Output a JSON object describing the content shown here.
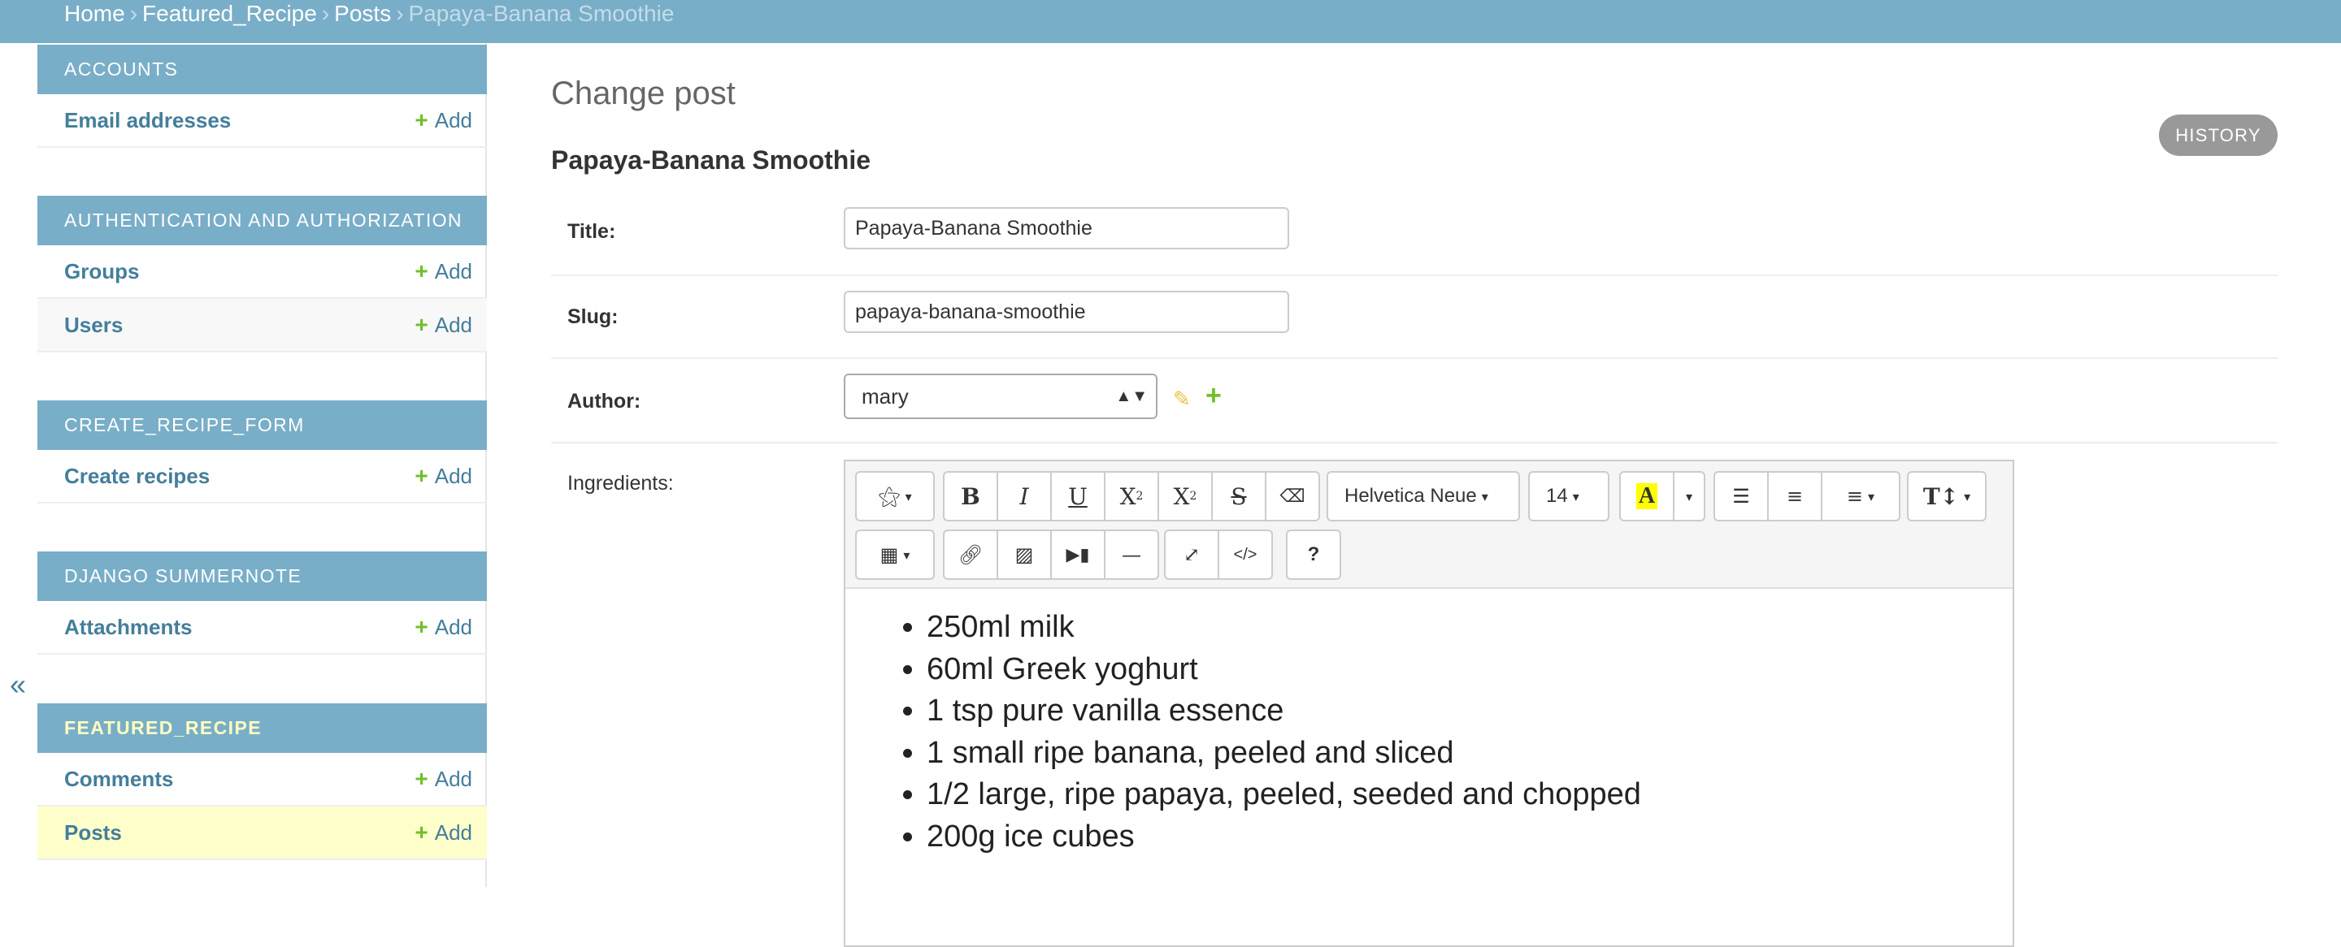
{
  "breadcrumbs": {
    "home": "Home",
    "app": "Featured_Recipe",
    "model": "Posts",
    "current": "Papaya-Banana Smoothie",
    "separator": "›"
  },
  "sidebar": {
    "add_label": "Add",
    "collapse_glyph": "«",
    "modules": [
      {
        "caption": "ACCOUNTS",
        "items": [
          {
            "label": "Email addresses"
          }
        ]
      },
      {
        "caption": "AUTHENTICATION AND AUTHORIZATION",
        "items": [
          {
            "label": "Groups"
          },
          {
            "label": "Users"
          }
        ]
      },
      {
        "caption": "CREATE_RECIPE_FORM",
        "items": [
          {
            "label": "Create recipes"
          }
        ]
      },
      {
        "caption": "DJANGO SUMMERNOTE",
        "items": [
          {
            "label": "Attachments"
          }
        ]
      },
      {
        "caption": "FEATURED_RECIPE",
        "items": [
          {
            "label": "Comments"
          },
          {
            "label": "Posts"
          }
        ]
      }
    ]
  },
  "content": {
    "page_title": "Change post",
    "history_button": "HISTORY",
    "object_title": "Papaya-Banana Smoothie",
    "fields": {
      "title": {
        "label": "Title:",
        "value": "Papaya-Banana Smoothie"
      },
      "slug": {
        "label": "Slug:",
        "value": "papaya-banana-smoothie"
      },
      "author": {
        "label": "Author:",
        "value": "mary"
      },
      "ingredients": {
        "label": "Ingredients:"
      }
    }
  },
  "editor": {
    "font_name": "Helvetica Neue",
    "font_size": "14",
    "help": "?",
    "codeview": "</>",
    "ingredients": [
      "250ml milk",
      "60ml Greek yoghurt",
      "1 tsp pure vanilla essence",
      "1 small ripe banana, peeled and sliced",
      "1/2 large, ripe papaya, peeled, seeded and chopped",
      "200g ice cubes"
    ]
  },
  "colors": {
    "header": "#79aec8",
    "link": "#447e9b",
    "add_green": "#70bf2b",
    "selected_row": "#ffffcc",
    "history_button": "#999999"
  }
}
